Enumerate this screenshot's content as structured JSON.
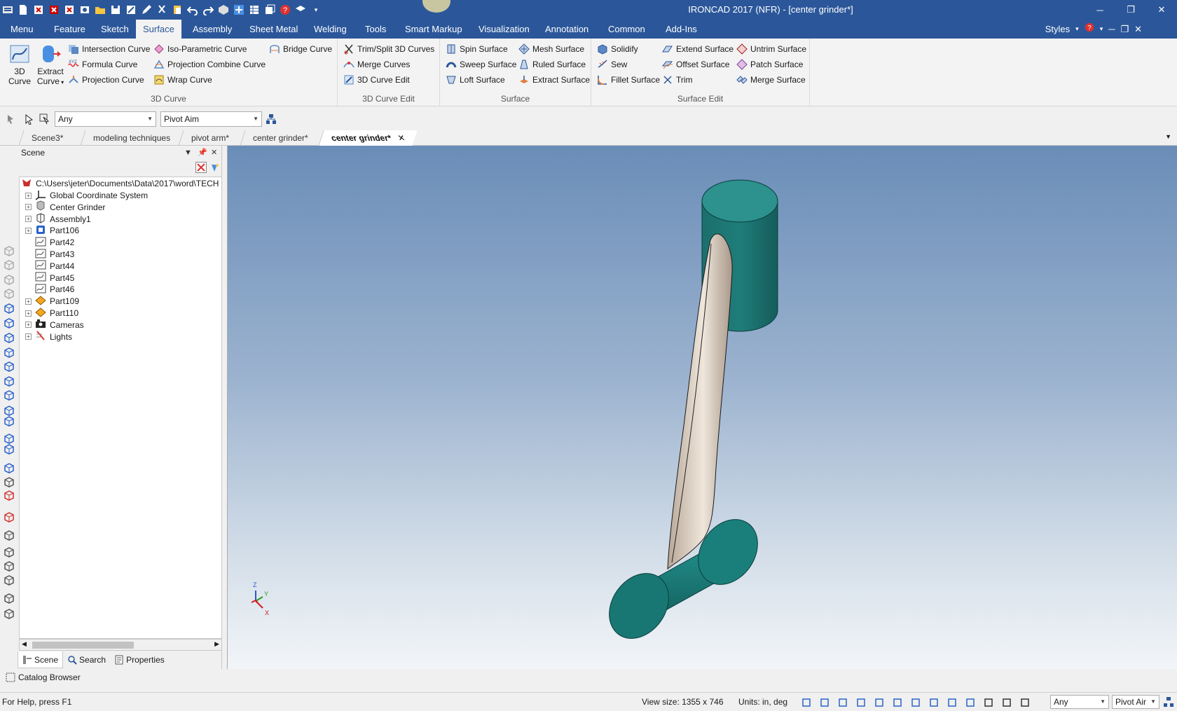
{
  "window": {
    "title": "IRONCAD 2017 (NFR) - [center grinder*]",
    "controls": [
      "minimize-icon",
      "restore-icon",
      "close-icon"
    ]
  },
  "colors": {
    "titlebar": "#2b579a",
    "ribbon": "#f3f3f3",
    "part_teal": "#1e7a78",
    "part_tan": "#d8cbbd",
    "viewport_top": "#6a8db8",
    "viewport_bottom": "#f2f5f8"
  },
  "menu": {
    "tabs": [
      "Menu",
      "Feature",
      "Sketch",
      "Surface",
      "Assembly",
      "Sheet Metal",
      "Welding",
      "Tools",
      "Smart Markup",
      "Visualization",
      "Annotation",
      "Common",
      "Add-Ins"
    ],
    "active": "Surface",
    "styles_label": "Styles"
  },
  "ribbon": {
    "groups": [
      {
        "label": "3D Curve",
        "big": [
          {
            "line1": "3D",
            "line2": "Curve"
          },
          {
            "line1": "Extract",
            "line2": "Curve"
          }
        ],
        "items": [
          "Intersection Curve",
          "Formula Curve",
          "Projection Curve",
          "Iso-Parametric Curve",
          "Projection Combine Curve",
          "Wrap Curve",
          "Bridge Curve"
        ]
      },
      {
        "label": "3D Curve Edit",
        "items": [
          "Trim/Split 3D Curves",
          "Merge Curves",
          "3D Curve Edit"
        ]
      },
      {
        "label": "Surface",
        "items": [
          "Spin Surface",
          "Sweep Surface",
          "Loft Surface",
          "Mesh Surface",
          "Ruled Surface",
          "Extract Surface"
        ]
      },
      {
        "label": "Surface Edit",
        "items": [
          "Solidify",
          "Sew",
          "Fillet Surface",
          "Extend Surface",
          "Offset Surface",
          "Trim",
          "Untrim Surface",
          "Patch Surface",
          "Merge Surface"
        ]
      }
    ]
  },
  "selection": {
    "filter": "Any",
    "mode": "Pivot Aim"
  },
  "doc_tabs": [
    "Scene3*",
    "modeling techniques",
    "pivot arm*",
    "center grinder*",
    "center grinder*"
  ],
  "doc_tab_active": "center grinder*",
  "scene": {
    "title": "Scene",
    "root": "C:\\Users\\jeter\\Documents\\Data\\2017\\word\\TECH",
    "nodes": [
      {
        "label": "Global Coordinate System",
        "icon": "axes-icon",
        "expandable": true
      },
      {
        "label": "Center Grinder",
        "icon": "assembly-gray-icon",
        "expandable": true
      },
      {
        "label": "Assembly1",
        "icon": "assembly-icon",
        "expandable": true
      },
      {
        "label": "Part106",
        "icon": "part-blue-icon",
        "expandable": true
      },
      {
        "label": "Part42",
        "icon": "curve-part-icon",
        "expandable": false
      },
      {
        "label": "Part43",
        "icon": "curve-part-icon",
        "expandable": false
      },
      {
        "label": "Part44",
        "icon": "curve-part-icon",
        "expandable": false
      },
      {
        "label": "Part45",
        "icon": "curve-part-icon",
        "expandable": false
      },
      {
        "label": "Part46",
        "icon": "curve-part-icon",
        "expandable": false
      },
      {
        "label": "Part109",
        "icon": "surface-part-icon",
        "expandable": true
      },
      {
        "label": "Part110",
        "icon": "surface-part-icon",
        "expandable": true
      },
      {
        "label": "Cameras",
        "icon": "camera-icon",
        "expandable": true
      },
      {
        "label": "Lights",
        "icon": "light-icon",
        "expandable": true
      }
    ],
    "panel_tabs": [
      "Scene",
      "Search",
      "Properties"
    ]
  },
  "triad": {
    "z": "Z",
    "y": "Y",
    "x": "X"
  },
  "catalog_label": "Catalog Browser",
  "status": {
    "help": "For Help, press F1",
    "view_size": "View size: 1355 x  746",
    "units": "Units: in, deg",
    "filter": "Any",
    "mode": "Pivot Air"
  }
}
